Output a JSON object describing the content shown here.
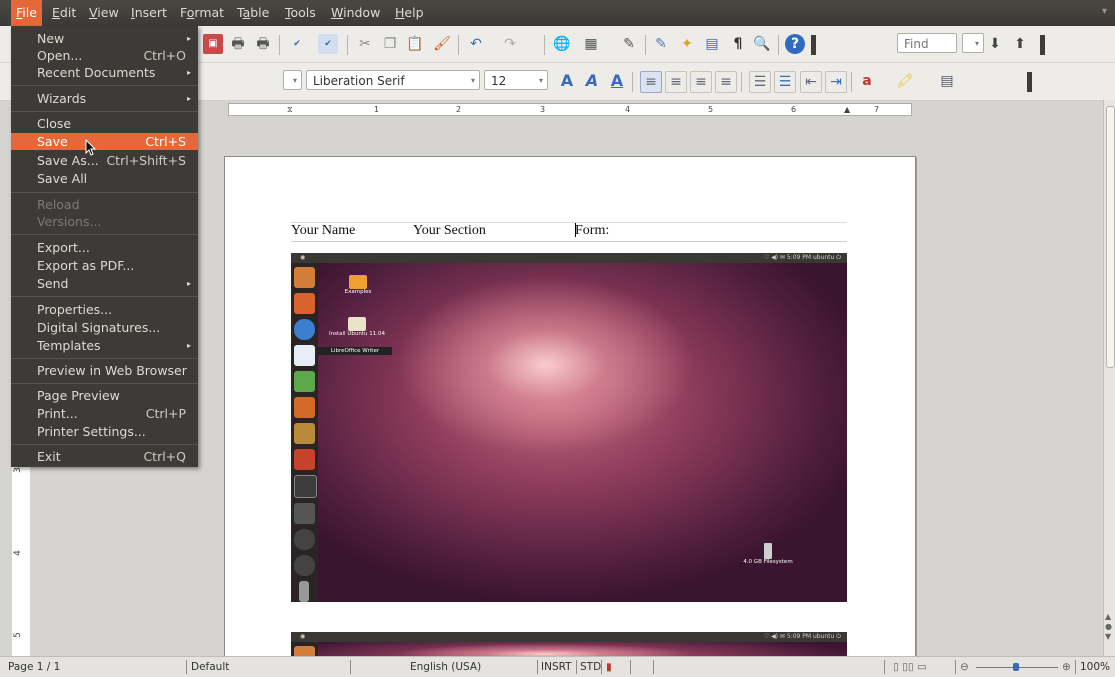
{
  "menubar": {
    "items": [
      {
        "label": "File",
        "mnemonic": "F",
        "rest": "ile"
      },
      {
        "label": "Edit",
        "mnemonic": "E",
        "rest": "dit"
      },
      {
        "label": "View",
        "mnemonic": "V",
        "rest": "iew"
      },
      {
        "label": "Insert",
        "mnemonic": "I",
        "rest": "nsert"
      },
      {
        "label": "Format",
        "pre": "F",
        "mnemonic": "o",
        "rest": "rmat"
      },
      {
        "label": "Table",
        "pre": "T",
        "mnemonic": "a",
        "rest": "ble"
      },
      {
        "label": "Tools",
        "mnemonic": "T",
        "rest": "ools"
      },
      {
        "label": "Window",
        "mnemonic": "W",
        "rest": "indow"
      },
      {
        "label": "Help",
        "mnemonic": "H",
        "rest": "elp"
      }
    ]
  },
  "file_menu": {
    "new": "New",
    "open": "Open...",
    "open_acc": "Ctrl+O",
    "recent": "Recent Documents",
    "wizards": "Wizards",
    "close": "Close",
    "save": "Save",
    "save_acc": "Ctrl+S",
    "save_as": "Save As...",
    "save_as_acc": "Ctrl+Shift+S",
    "save_all": "Save All",
    "reload": "Reload",
    "versions": "Versions...",
    "export": "Export...",
    "export_pdf": "Export as PDF...",
    "send": "Send",
    "properties": "Properties...",
    "digital_signatures": "Digital Signatures...",
    "templates": "Templates",
    "preview_web": "Preview in Web Browser",
    "page_preview": "Page Preview",
    "print": "Print...",
    "print_acc": "Ctrl+P",
    "printer_settings": "Printer Settings...",
    "exit": "Exit",
    "exit_acc": "Ctrl+Q"
  },
  "toolbar": {
    "find_placeholder": "Find",
    "font_name": "Liberation Serif",
    "font_size": "12"
  },
  "ruler": {
    "h_numbers": [
      "1",
      "2",
      "3",
      "4",
      "5",
      "6",
      "7"
    ],
    "v_numbers": [
      "3",
      "4",
      "5"
    ]
  },
  "document": {
    "header_name": "Your Name",
    "header_section": "Your Section",
    "header_form": "Form:"
  },
  "embedded_screenshot": {
    "topbar_right": "5:09 PM  ubuntu",
    "examples_label": "Examples",
    "install_label": "Install Ubuntu 11.04",
    "tooltip": "LibreOffice Writer",
    "filesystem_label": "4.0 GB Filesystem"
  },
  "statusbar": {
    "page": "Page 1 / 1",
    "style": "Default",
    "language": "English (USA)",
    "insert_mode": "INSRT",
    "selection_mode": "STD",
    "zoom": "100%"
  },
  "colors": {
    "accent": "#e4683a",
    "menu_bg": "#3c3b37",
    "menubar_bg": "#3b3a36"
  }
}
